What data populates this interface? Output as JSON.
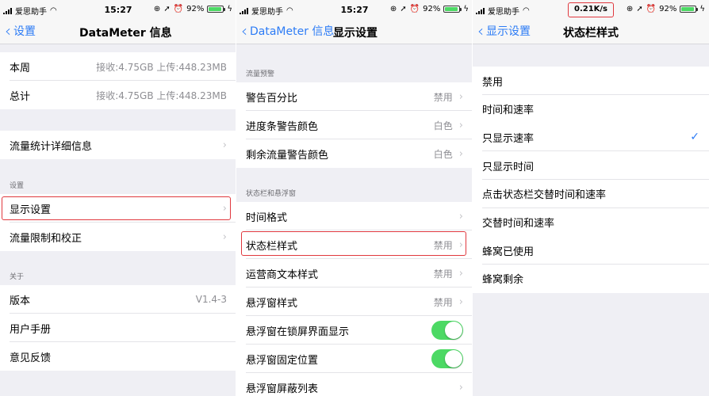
{
  "status": {
    "carrier": "爱思助手",
    "time": "15:27",
    "battery": "92%",
    "battery_level": 0.92,
    "speed": "0.21K/s"
  },
  "panel1": {
    "nav": {
      "back": "设置",
      "title": "DataMeter 信息"
    },
    "stats": [
      {
        "label": "本周",
        "value": "接收:4.75GB 上传:448.23MB"
      },
      {
        "label": "总计",
        "value": "接收:4.75GB 上传:448.23MB"
      }
    ],
    "detail": "流量统计详细信息",
    "settings_header": "设置",
    "settings": [
      "显示设置",
      "流量限制和校正"
    ],
    "about_header": "关于",
    "about": [
      {
        "label": "版本",
        "value": "V1.4-3"
      },
      {
        "label": "用户手册",
        "value": ""
      },
      {
        "label": "意见反馈",
        "value": ""
      }
    ]
  },
  "panel2": {
    "nav": {
      "back": "DataMeter 信息",
      "title": "显示设置"
    },
    "warning_header": "流量预警",
    "warning": [
      {
        "label": "警告百分比",
        "value": "禁用"
      },
      {
        "label": "进度条警告颜色",
        "value": "白色"
      },
      {
        "label": "剩余流量警告颜色",
        "value": "白色"
      }
    ],
    "status_header": "状态栏和悬浮窗",
    "status_rows": [
      {
        "label": "时间格式",
        "value": ""
      },
      {
        "label": "状态栏样式",
        "value": "禁用"
      },
      {
        "label": "运营商文本样式",
        "value": "禁用"
      },
      {
        "label": "悬浮窗样式",
        "value": "禁用"
      },
      {
        "label": "悬浮窗在锁屏界面显示",
        "toggle": true
      },
      {
        "label": "悬浮窗固定位置",
        "toggle": true
      },
      {
        "label": "悬浮窗屏蔽列表",
        "value": ""
      }
    ]
  },
  "panel3": {
    "nav": {
      "back": "显示设置",
      "title": "状态栏样式"
    },
    "options": [
      "禁用",
      "时间和速率",
      "只显示速率",
      "只显示时间",
      "点击状态栏交替时间和速率",
      "交替时间和速率",
      "蜂窝已使用",
      "蜂窝剩余"
    ],
    "selected_index": 2,
    "check": "✓"
  },
  "colors": {
    "accent": "#2d7cf6",
    "highlight": "#e0383e",
    "toggle_on": "#4cd964"
  }
}
